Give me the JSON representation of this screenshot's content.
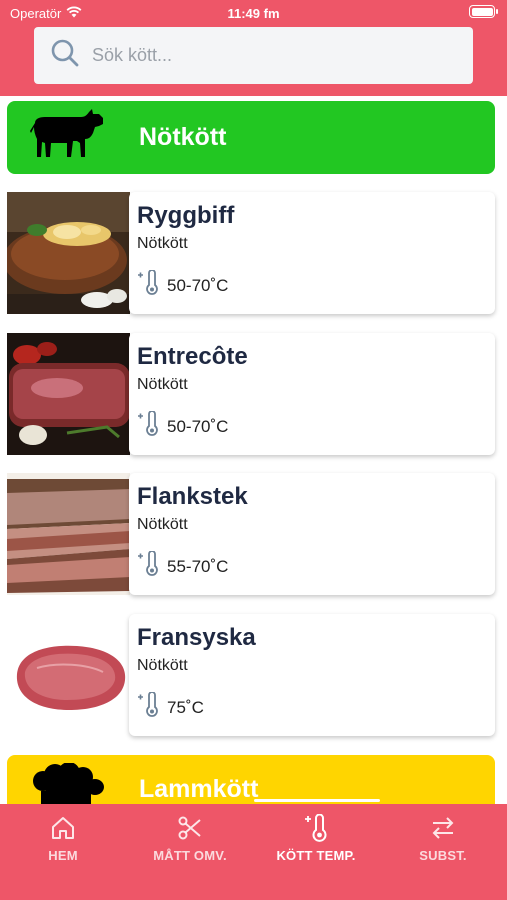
{
  "status": {
    "carrier": "Operatör",
    "time": "11:49 fm"
  },
  "search": {
    "placeholder": "Sök kött..."
  },
  "categories": [
    {
      "title": "Nötkött",
      "color": "#22c722",
      "icon": "cow-icon"
    },
    {
      "title": "Lammkött",
      "color": "#ffd500",
      "icon": "sheep-icon"
    }
  ],
  "items": [
    {
      "name": "Ryggbiff",
      "category": "Nötkött",
      "temp": "50-70˚C",
      "image": "steak-photo"
    },
    {
      "name": "Entrecôte",
      "category": "Nötkött",
      "temp": "50-70˚C",
      "image": "entrecote-photo"
    },
    {
      "name": "Flankstek",
      "category": "Nötkött",
      "temp": "55-70˚C",
      "image": "flank-steak-photo"
    },
    {
      "name": "Fransyska",
      "category": "Nötkött",
      "temp": "75˚C",
      "image": "raw-beef-photo"
    }
  ],
  "tabs": [
    {
      "label": "HEM",
      "icon": "home-icon"
    },
    {
      "label": "MÅTT OMV.",
      "icon": "scissors-icon"
    },
    {
      "label": "KÖTT TEMP.",
      "icon": "thermometer-icon",
      "active": true
    },
    {
      "label": "SUBST.",
      "icon": "swap-arrows-icon"
    }
  ],
  "colors": {
    "accent": "#ee5668",
    "beef": "#22c722",
    "lamb": "#ffd500",
    "text": "#1f2942"
  }
}
